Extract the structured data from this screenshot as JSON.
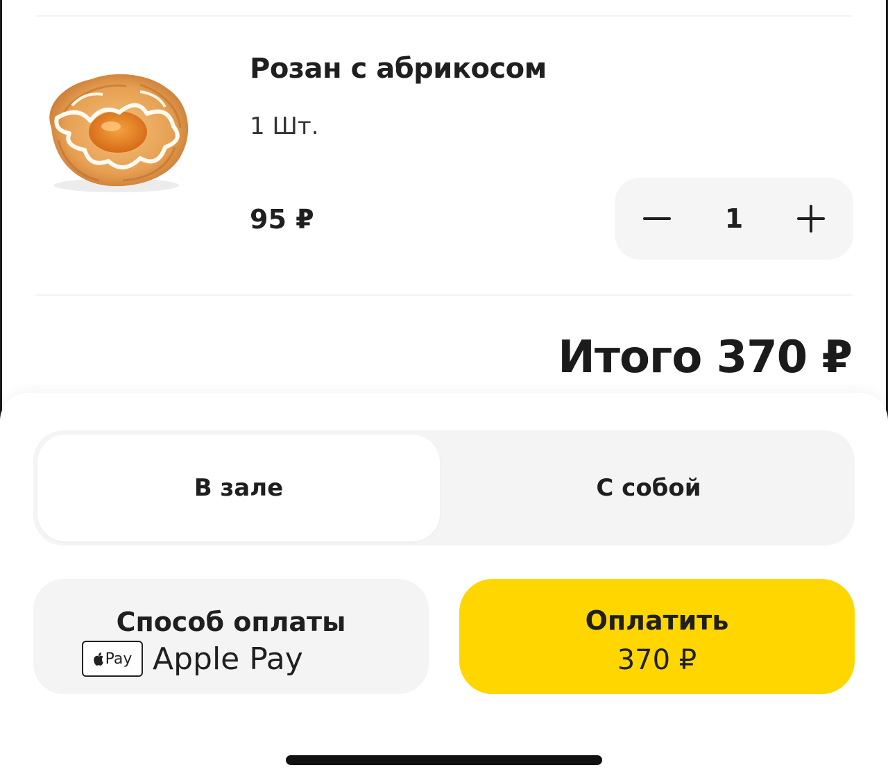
{
  "cart_item": {
    "name": "Розан с абрикосом",
    "unit": "1 Шт.",
    "price": "95 ₽",
    "quantity": "1",
    "image_icon": "apricot-pastry-image"
  },
  "total": {
    "label": "Итого 370 ₽"
  },
  "order_type": {
    "options": [
      {
        "label": "В зале",
        "selected": true
      },
      {
        "label": "С собой",
        "selected": false
      }
    ]
  },
  "payment": {
    "title": "Способ оплаты",
    "badge_label": "Pay",
    "method": "Apple Pay"
  },
  "pay_button": {
    "label": "Оплатить",
    "amount": "370 ₽"
  },
  "colors": {
    "accent": "#ffd600",
    "surface": "#f4f4f4",
    "text": "#1f1f1f"
  }
}
